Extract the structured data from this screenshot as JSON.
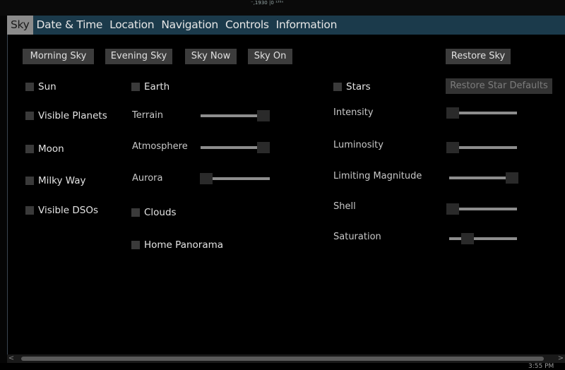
{
  "window": {
    "top_coords": "⁻,1930  |0  ¹³⁵ˣ"
  },
  "tabs": [
    {
      "label": "Sky",
      "active": true
    },
    {
      "label": "Date & Time",
      "active": false
    },
    {
      "label": "Location",
      "active": false
    },
    {
      "label": "Navigation",
      "active": false
    },
    {
      "label": "Controls",
      "active": false
    },
    {
      "label": "Information",
      "active": false
    }
  ],
  "buttons": {
    "morning_sky": "Morning Sky",
    "evening_sky": "Evening Sky",
    "sky_now": "Sky Now",
    "sky_on": "Sky On",
    "restore_sky": "Restore Sky",
    "restore_star_defaults": "Restore Star Defaults"
  },
  "col1": {
    "sun": "Sun",
    "visible_planets": "Visible Planets",
    "moon": "Moon",
    "milky_way": "Milky Way",
    "visible_dsos": "Visible DSOs"
  },
  "col2": {
    "earth": "Earth",
    "terrain": "Terrain",
    "atmosphere": "Atmosphere",
    "aurora": "Aurora",
    "clouds": "Clouds",
    "home_panorama": "Home Panorama"
  },
  "col3": {
    "stars": "Stars",
    "intensity": "Intensity",
    "luminosity": "Luminosity",
    "limiting_magnitude": "Limiting Magnitude",
    "shell": "Shell",
    "saturation": "Saturation"
  },
  "sliders": {
    "terrain": 0.93,
    "atmosphere": 0.93,
    "aurora": 0.06,
    "intensity": 0.05,
    "luminosity": 0.05,
    "limiting_magnitude": 0.93,
    "shell": 0.05,
    "saturation": 0.27
  },
  "scrollbar": {
    "left_arrow": "<",
    "right_arrow": ">"
  },
  "taskbar": {
    "time": "3:55 PM"
  }
}
